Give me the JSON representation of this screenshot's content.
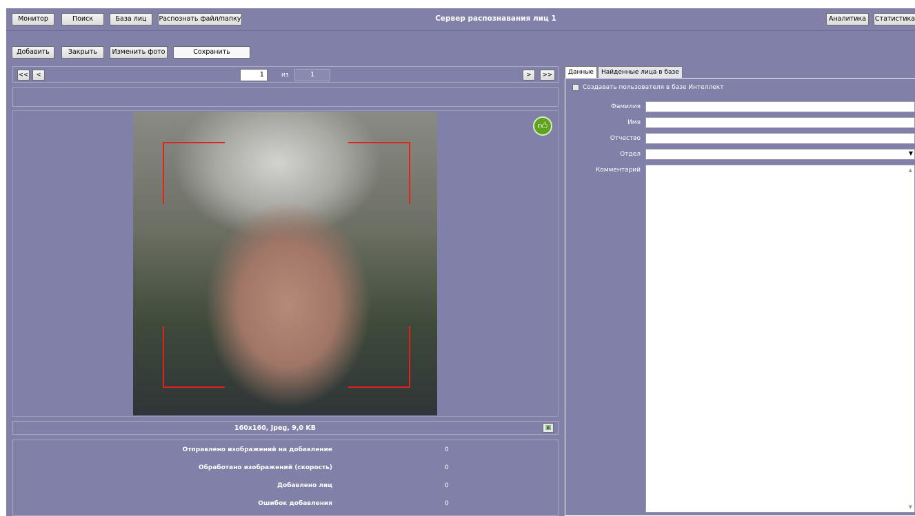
{
  "header": {
    "title": "Сервер распознавания лиц 1",
    "left_buttons": [
      "Монитор",
      "Поиск",
      "База лиц",
      "Распознать файл/папку"
    ],
    "right_buttons": [
      "Аналитика",
      "Статистика"
    ]
  },
  "toolbar": {
    "add": "Добавить",
    "close": "Закрыть",
    "change_photo": "Изменить фото",
    "save": "Сохранить"
  },
  "pager": {
    "first": "<<",
    "prev": "<",
    "next": ">",
    "last": ">>",
    "current": "1",
    "of": "из",
    "total": "1"
  },
  "image_info": "160x160, Jpeg, 9,0 KB",
  "stats": [
    {
      "label": "Отправлено изображений на добавление",
      "value": "0"
    },
    {
      "label": "Обработано изображений (скорость)",
      "value": "0"
    },
    {
      "label": "Добавлено лиц",
      "value": "0"
    },
    {
      "label": "Ошибок добавления",
      "value": "0"
    }
  ],
  "right_panel": {
    "tabs": [
      "Данные",
      "Найденные лица в базе"
    ],
    "checkbox_label": "Создавать пользователя в базе Интеллект",
    "fields": {
      "surname": "Фамилия",
      "name": "Имя",
      "patronymic": "Отчество",
      "department": "Отдел",
      "comment": "Комментарий"
    }
  },
  "colors": {
    "background": "#8080a8",
    "accept_badge": "#5ea21f",
    "crop_frame": "#e0241c"
  }
}
